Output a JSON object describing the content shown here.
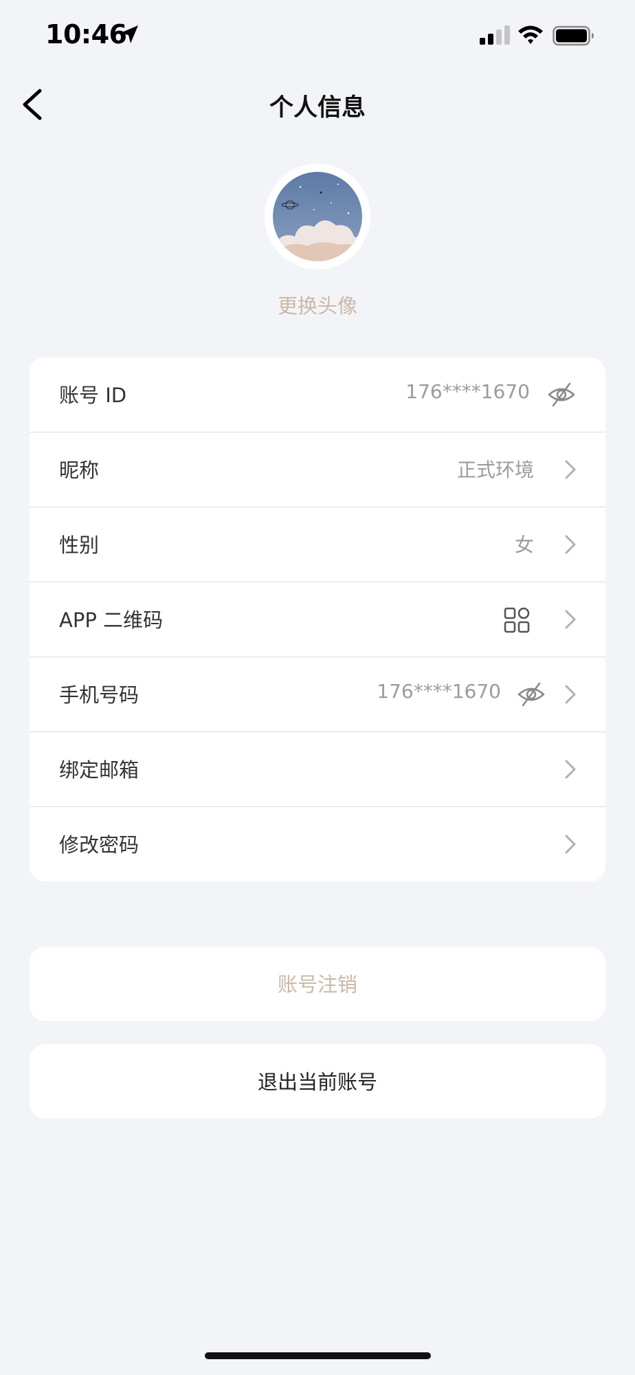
{
  "status_bar": {
    "time": "10:46"
  },
  "nav": {
    "title": "个人信息"
  },
  "avatar": {
    "change_label": "更换头像"
  },
  "info_rows": [
    {
      "label": "账号 ID",
      "value": "176****1670",
      "trailing_icon": "eye-off-icon"
    },
    {
      "label": "昵称",
      "value": "正式环境",
      "trailing_icon": "chevron-right-icon"
    },
    {
      "label": "性别",
      "value": "女",
      "trailing_icon": "chevron-right-icon"
    },
    {
      "label": "APP 二维码",
      "value_icon": "qr-code-icon",
      "trailing_icon": "chevron-right-icon"
    },
    {
      "label": "手机号码",
      "value": "176****1670",
      "value_icon": "eye-off-icon",
      "trailing_icon": "chevron-right-icon"
    },
    {
      "label": "绑定邮箱",
      "trailing_icon": "chevron-right-icon"
    },
    {
      "label": "修改密码",
      "trailing_icon": "chevron-right-icon"
    }
  ],
  "actions": {
    "deactivate_label": "账号注销",
    "logout_label": "退出当前账号"
  },
  "colors": {
    "background": "#f3f4f8",
    "accent_text": "#cbb8a6",
    "secondary_text": "#9b9b9b"
  }
}
